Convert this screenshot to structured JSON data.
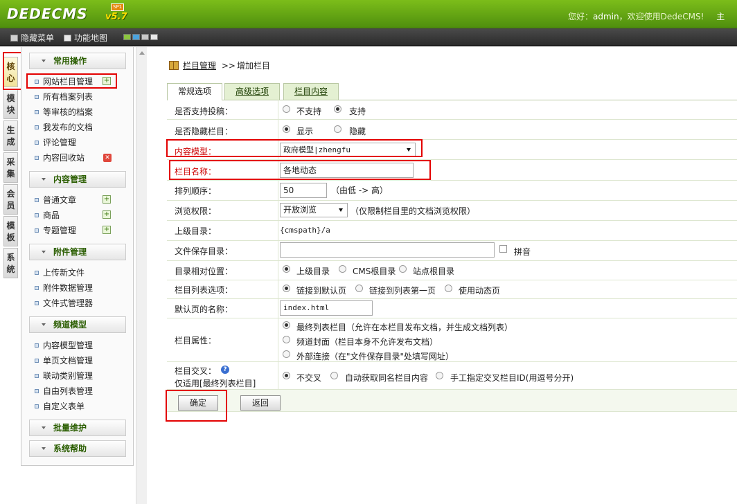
{
  "header": {
    "logo": "DEDECMS",
    "version": "v5.7",
    "sp_badge": "SP1",
    "welcome_prefix": "您好：",
    "username": "admin",
    "welcome_suffix": "，欢迎使用DedeCMS!",
    "right_link": "主"
  },
  "toolbar": {
    "hide_menu": "隐藏菜单",
    "function_map": "功能地图",
    "swatch_colors": [
      "#8cc63f",
      "#4aa3df",
      "#c9c9c9",
      "#e8e8e8"
    ]
  },
  "vtabs": [
    {
      "label": "核心",
      "active": true
    },
    {
      "label": "模块",
      "active": false
    },
    {
      "label": "生成",
      "active": false
    },
    {
      "label": "采集",
      "active": false
    },
    {
      "label": "会员",
      "active": false
    },
    {
      "label": "模板",
      "active": false
    },
    {
      "label": "系统",
      "active": false
    }
  ],
  "menu": {
    "sections": [
      {
        "title": "常用操作",
        "items": [
          "网站栏目管理",
          "所有档案列表",
          "等审核的档案",
          "我发布的文档",
          "评论管理",
          "内容回收站"
        ]
      },
      {
        "title": "内容管理",
        "items": [
          "普通文章",
          "商品",
          "专题管理"
        ]
      },
      {
        "title": "附件管理",
        "items": [
          "上传新文件",
          "附件数据管理",
          "文件式管理器"
        ]
      },
      {
        "title": "频道模型",
        "items": [
          "内容模型管理",
          "单页文档管理",
          "联动类别管理",
          "自由列表管理",
          "自定义表单"
        ]
      },
      {
        "title": "批量维护",
        "items": []
      },
      {
        "title": "系统帮助",
        "items": []
      }
    ]
  },
  "breadcrumb": {
    "link": "栏目管理",
    "separator": ">>",
    "current": "增加栏目"
  },
  "tabs": [
    {
      "label": "常规选项",
      "active": true
    },
    {
      "label": "高级选项",
      "active": false
    },
    {
      "label": "栏目内容",
      "active": false
    }
  ],
  "form": {
    "allow_submit": {
      "label": "是否支持投稿：",
      "options": [
        "不支持",
        "支持"
      ],
      "selected": 1
    },
    "hidden": {
      "label": "是否隐藏栏目：",
      "options": [
        "显示",
        "隐藏"
      ],
      "selected": 0
    },
    "model": {
      "label": "内容模型：",
      "value": "政府模型|zhengfu"
    },
    "name": {
      "label": "栏目名称：",
      "value": "各地动态"
    },
    "order": {
      "label": "排列顺序：",
      "value": "50",
      "hint": "（由低 -> 高）"
    },
    "permission": {
      "label": "浏览权限：",
      "value": "开放浏览",
      "hint": "（仅限制栏目里的文档浏览权限）"
    },
    "parent_dir": {
      "label": "上级目录：",
      "value": "{cmspath}/a"
    },
    "save_dir": {
      "label": "文件保存目录：",
      "value": "",
      "pinyin": "拼音"
    },
    "relative_pos": {
      "label": "目录相对位置：",
      "options": [
        "上级目录",
        "CMS根目录",
        "站点根目录"
      ],
      "selected": 0
    },
    "list_option": {
      "label": "栏目列表选项：",
      "options": [
        "链接到默认页",
        "链接到列表第一页",
        "使用动态页"
      ],
      "selected": 0
    },
    "default_page": {
      "label": "默认页的名称：",
      "value": "index.html"
    },
    "attribute": {
      "label": "栏目属性：",
      "options": [
        "最终列表栏目（允许在本栏目发布文档，并生成文档列表）",
        "频道封面（栏目本身不允许发布文档）",
        "外部连接（在\"文件保存目录\"处填写网址）"
      ],
      "selected": 0
    },
    "cross": {
      "label": "栏目交叉：",
      "sublabel": "仅适用[最终列表栏目]",
      "options": [
        "不交叉",
        "自动获取同名栏目内容",
        "手工指定交叉栏目ID(用逗号分开)"
      ],
      "selected": 0
    }
  },
  "buttons": {
    "submit": "确定",
    "back": "返回"
  }
}
